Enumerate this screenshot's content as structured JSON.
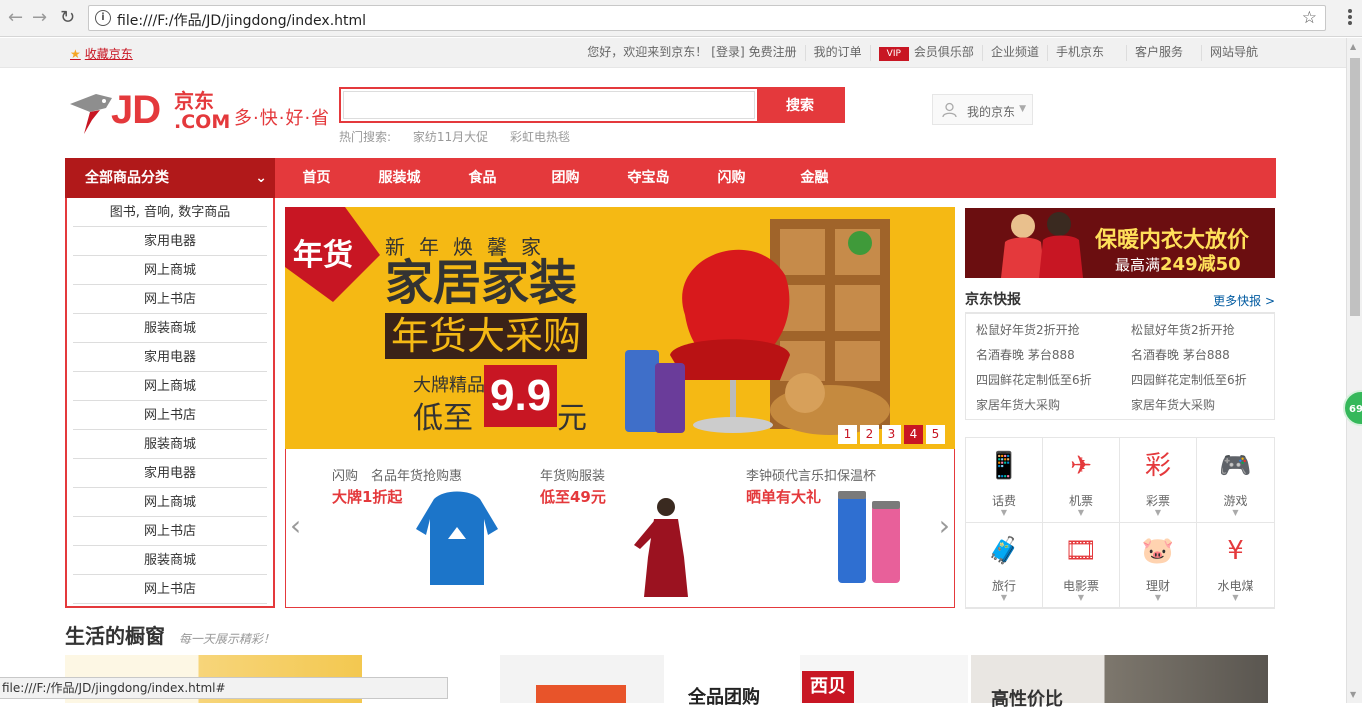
{
  "browser": {
    "url": "file:///F:/作品/JD/jingdong/index.html",
    "status_url": "file:///F:/作品/JD/jingdong/index.html#"
  },
  "topbar": {
    "favorite": "收藏京东",
    "greeting": "您好，欢迎来到京东！",
    "login": "[登录]",
    "register": "免费注册",
    "orders": "我的订单",
    "vip_badge": "VIP",
    "club": "会员俱乐部",
    "enterprise": "企业频道",
    "mobile": "手机京东",
    "service": "客户服务",
    "sitemap": "网站导航"
  },
  "header": {
    "logo_jd": "JD",
    "logo_cn": "京东",
    "logo_com": ".COM",
    "slogan": "多·快·好·省",
    "search_placeholder": "",
    "search_button": "搜索",
    "hot_label": "热门搜索:",
    "hot_items": [
      "家纺11月大促",
      "彩虹电热毯"
    ],
    "my_jd": "我的京东"
  },
  "nav": {
    "all_categories": "全部商品分类",
    "items": [
      "首页",
      "服装城",
      "食品",
      "团购",
      "夺宝岛",
      "闪购",
      "金融"
    ]
  },
  "categories": [
    "图书, 音响, 数字商品",
    "家用电器",
    "网上商城",
    "网上书店",
    "服装商城",
    "家用电器",
    "网上商城",
    "网上书店",
    "服装商城",
    "家用电器",
    "网上商城",
    "网上书店",
    "服装商城",
    "网上书店"
  ],
  "banner": {
    "tag": "年货",
    "subtitle": "新年焕馨家",
    "headline": "家居家装",
    "box": "年货大采购",
    "line1": "大牌精品",
    "line2": "低至",
    "price": "9.9",
    "unit": "元",
    "dots": [
      "1",
      "2",
      "3",
      "4",
      "5"
    ],
    "active_dot": 4
  },
  "promos": [
    {
      "title": "闪购　名品年货抢购惠",
      "highlight": "大牌1折起"
    },
    {
      "title": "年货购服装",
      "highlight": "低至49元"
    },
    {
      "title": "李钟硕代言乐扣保温杯",
      "highlight": "晒单有大礼"
    }
  ],
  "ad": {
    "title": "保暖内衣大放价",
    "prefix": "最高满",
    "amount": "249减50"
  },
  "news": {
    "title": "京东快报",
    "more": "更多快报 >",
    "col1": [
      "松鼠好年货2折开抢",
      "名酒春晚 茅台888",
      "四园鲜花定制低至6折",
      "家居年货大采购"
    ],
    "col2": [
      "松鼠好年货2折开抢",
      "名酒春晚 茅台888",
      "四园鲜花定制低至6折",
      "家居年货大采购"
    ]
  },
  "services": [
    {
      "label": "话费",
      "icon": "phone-icon",
      "glyph": "📱"
    },
    {
      "label": "机票",
      "icon": "plane-icon",
      "glyph": "✈"
    },
    {
      "label": "彩票",
      "icon": "lottery-icon",
      "glyph": "彩"
    },
    {
      "label": "游戏",
      "icon": "gamepad-icon",
      "glyph": "🎮"
    },
    {
      "label": "旅行",
      "icon": "suitcase-icon",
      "glyph": "🧳"
    },
    {
      "label": "电影票",
      "icon": "film-icon",
      "glyph": "🎞"
    },
    {
      "label": "理财",
      "icon": "piggybank-icon",
      "glyph": "🐷"
    },
    {
      "label": "水电煤",
      "icon": "yen-icon",
      "glyph": "¥"
    }
  ],
  "section": {
    "title": "生活的橱窗",
    "subtitle": "每一天展示精彩！",
    "tile_text": "全品团购",
    "tile_text2": "高性价比",
    "tile_logo": "西贝"
  },
  "badge": "69"
}
